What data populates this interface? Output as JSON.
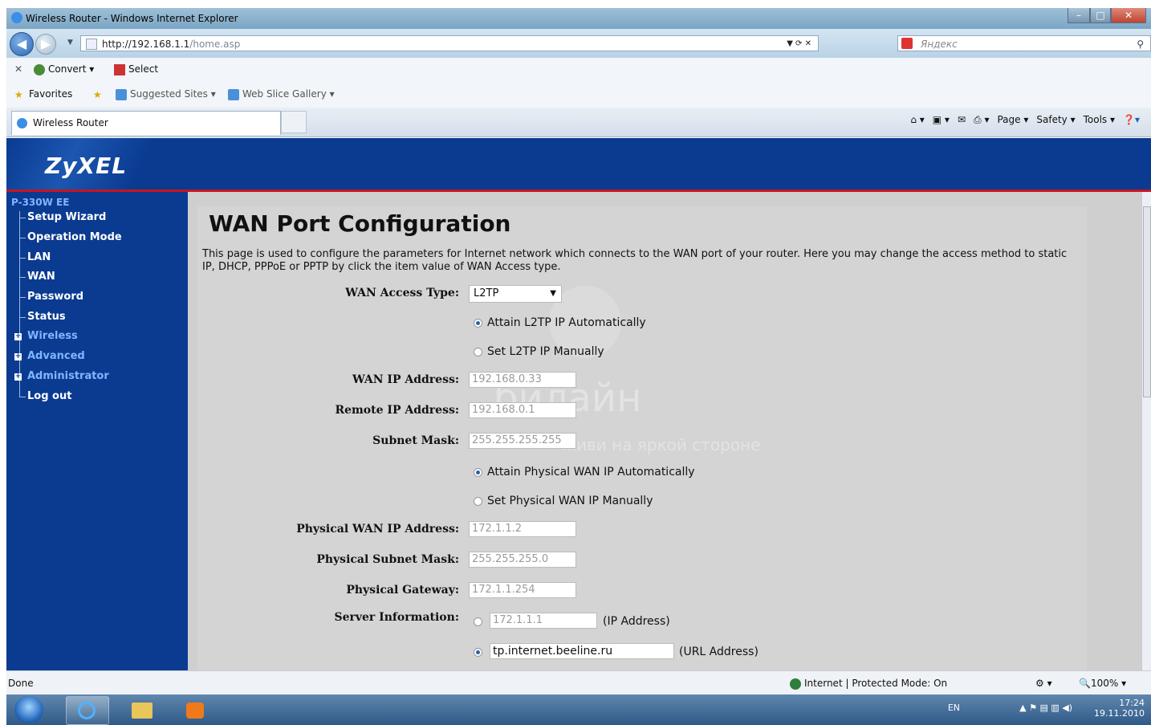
{
  "window": {
    "title": "Wireless Router - Windows Internet Explorer"
  },
  "addressbar": {
    "url_bold": "http://192.168.1.1",
    "url_rest": "/home.asp",
    "search_placeholder": "Яндекс"
  },
  "commandbar": {
    "convert": "Convert",
    "select": "Select"
  },
  "favbar": {
    "favorites": "Favorites",
    "suggested": "Suggested Sites",
    "webslice": "Web Slice Gallery"
  },
  "tabs": {
    "active": "Wireless Router"
  },
  "ie_tools": {
    "page": "Page",
    "safety": "Safety",
    "tools": "Tools"
  },
  "router": {
    "brand": "ZyXEL",
    "model": "P-330W EE",
    "menu": [
      {
        "label": "Setup Wizard"
      },
      {
        "label": "Operation Mode"
      },
      {
        "label": "LAN"
      },
      {
        "label": "WAN"
      },
      {
        "label": "Password"
      },
      {
        "label": "Status"
      },
      {
        "label": "Wireless"
      },
      {
        "label": "Advanced"
      },
      {
        "label": "Administrator"
      },
      {
        "label": "Log out"
      }
    ]
  },
  "page": {
    "title": "WAN Port Configuration",
    "description": "This page is used to configure the parameters for Internet network which connects to the WAN port of your router. Here you may change the access method to static IP, DHCP, PPPoE or PPTP by click the item value of WAN Access type."
  },
  "form": {
    "wan_access_type_label": "WAN Access Type:",
    "wan_access_type_value": "L2TP",
    "l2tp_auto": "Attain L2TP IP Automatically",
    "l2tp_manual": "Set L2TP IP Manually",
    "wan_ip_label": "WAN IP Address:",
    "wan_ip_value": "192.168.0.33",
    "remote_ip_label": "Remote IP Address:",
    "remote_ip_value": "192.168.0.1",
    "subnet_label": "Subnet Mask:",
    "subnet_value": "255.255.255.255",
    "phys_auto": "Attain Physical WAN IP Automatically",
    "phys_manual": "Set Physical WAN IP Manually",
    "phys_ip_label": "Physical WAN IP Address:",
    "phys_ip_value": "172.1.1.2",
    "phys_mask_label": "Physical Subnet Mask:",
    "phys_mask_value": "255.255.255.0",
    "phys_gw_label": "Physical Gateway:",
    "phys_gw_value": "172.1.1.254",
    "server_label": "Server Information:",
    "server_ip_value": "172.1.1.1",
    "server_ip_hint": "(IP Address)",
    "server_url_value": "tp.internet.beeline.ru",
    "server_url_hint": "(URL Address)"
  },
  "watermark": {
    "line1": "билайн",
    "line2": "живи на яркой стороне"
  },
  "statusbar": {
    "left": "Done",
    "zone": "Internet | Protected Mode: On",
    "zoom": "100%"
  },
  "taskbar": {
    "lang": "EN",
    "time": "17:24",
    "date": "19.11.2010"
  }
}
